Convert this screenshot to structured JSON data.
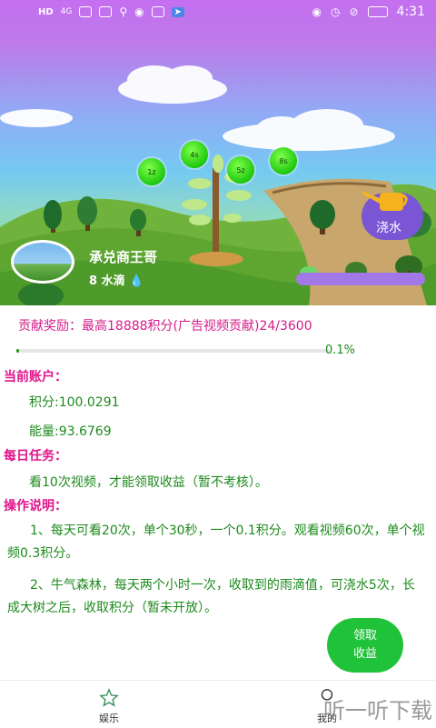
{
  "statusbar": {
    "left_icons": [
      "hd-icon",
      "signal-icon",
      "wifi-icon",
      "app-icon",
      "usb-icon",
      "chat-icon",
      "shield-icon",
      "send-icon"
    ],
    "network": "HD",
    "signal_label": "4G",
    "battery_icon": "battery-icon",
    "time": "4:31"
  },
  "hero": {
    "bubbles": [
      "1z",
      "4s",
      "5z",
      "8s"
    ],
    "user_name": "承兑商王哥",
    "water_drops": "8 水滴",
    "water_button": "浇水",
    "growth_stage_icons": [
      "sprout-icon",
      "small-tree-icon",
      "big-tree-icon"
    ],
    "colors": {
      "sky_top": "#c46ff0",
      "sky_bottom": "#74c9f2",
      "grass": "#87c456",
      "water_button": "#7a55d4"
    }
  },
  "contribution": {
    "label": "贡献奖励：",
    "text": "最高18888积分(广告视频贡献)24/3600",
    "progress": 0.001,
    "percent": "0.1%"
  },
  "account": {
    "title": "当前账户：",
    "points": "积分:100.0291",
    "energy": "能量:93.6769"
  },
  "daily_tasks": {
    "title": "每日任务：",
    "text": "看10次视频，才能领取收益（暂不考核）。"
  },
  "instructions": {
    "title": "操作说明：",
    "item1": "1、每天可看20次，单个30秒，一个0.1积分。观看视频60次，单个视频0.3积分。",
    "item2": "2、牛气森林，每天两个小时一次，收取到的雨滴值，可浇水5次，长成大树之后，收取积分（暂未开放）。"
  },
  "claim_button": {
    "line1": "领取",
    "line2": "收益"
  },
  "bottom_nav": {
    "items": [
      {
        "label": "娱乐",
        "icon": "star-icon"
      },
      {
        "label": "我的",
        "icon": "profile-icon"
      }
    ]
  },
  "watermark": "听一听下载",
  "colors": {
    "accent_green": "#1c8a1c",
    "heading_pink": "#e0148a",
    "claim_button": "#20c23a"
  }
}
